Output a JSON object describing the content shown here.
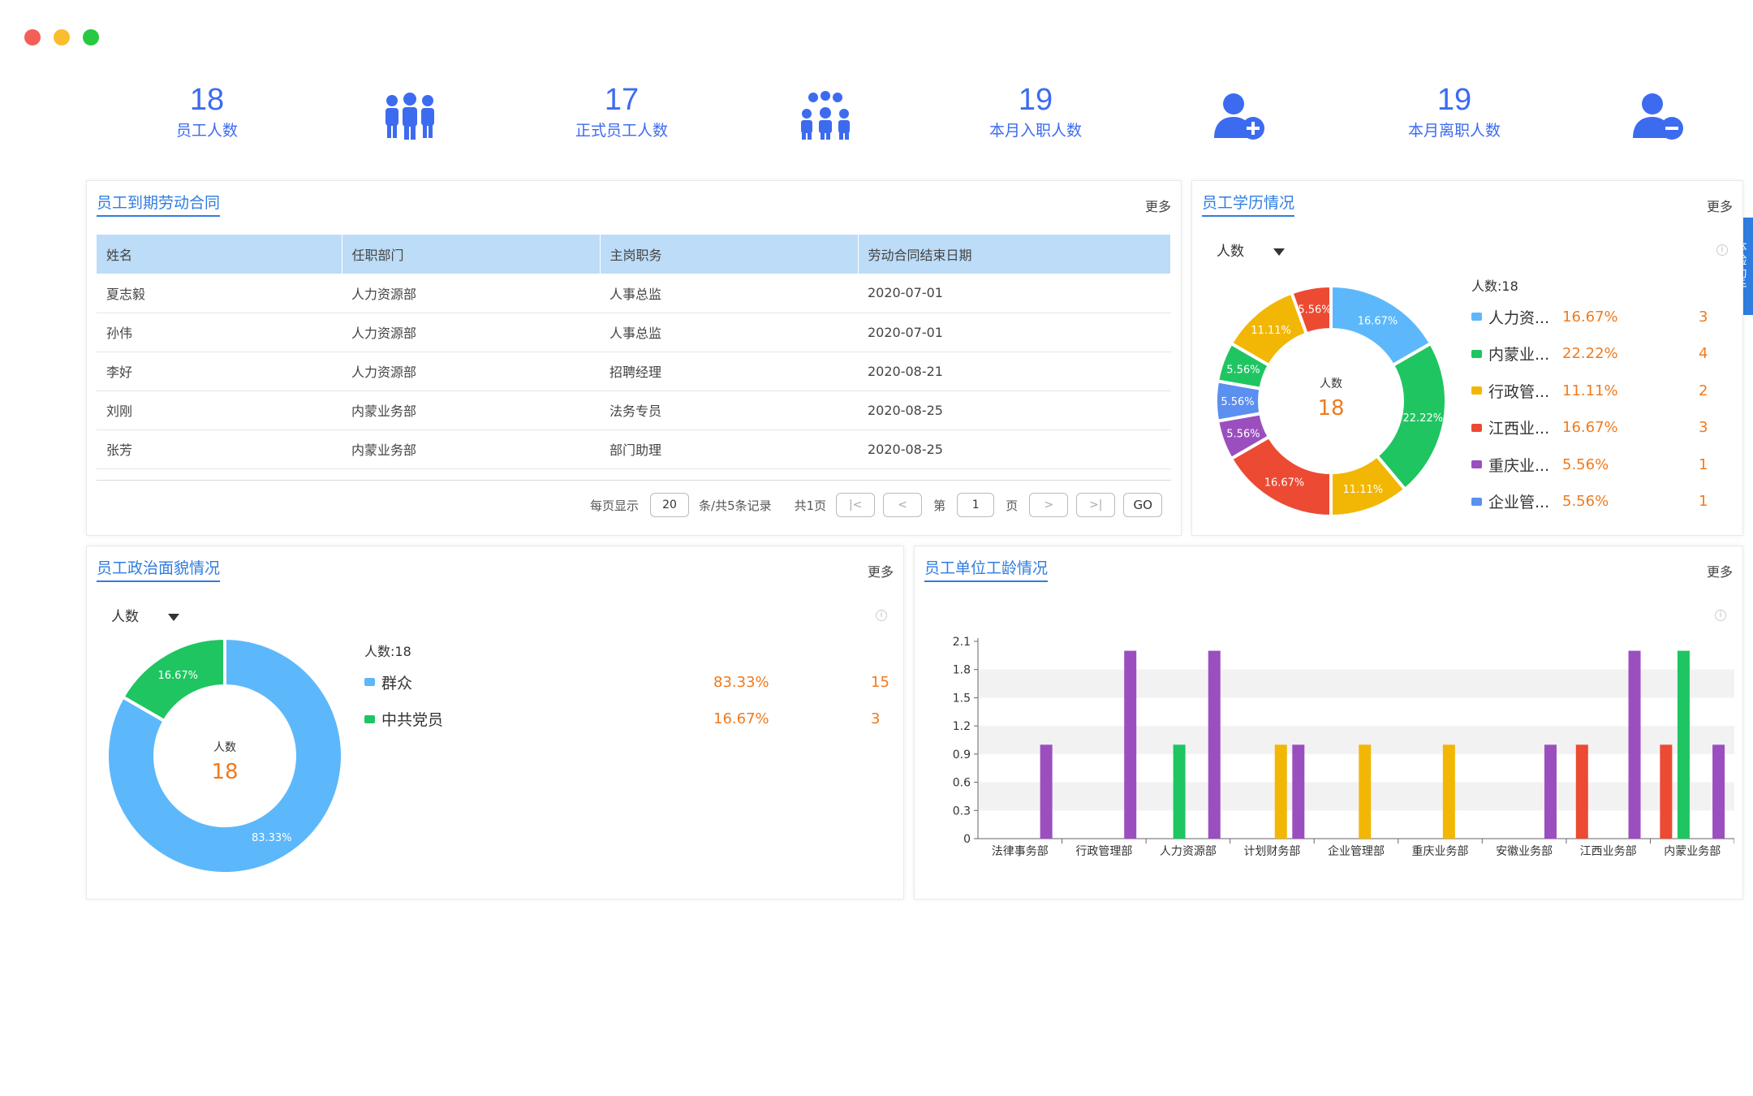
{
  "window": {
    "dots": [
      "#f45f57",
      "#fbbd2e",
      "#28c840"
    ]
  },
  "stats": [
    {
      "value": "18",
      "label": "员工人数",
      "icon": "group-icon"
    },
    {
      "value": "17",
      "label": "正式员工人数",
      "icon": "group-icon"
    },
    {
      "value": "19",
      "label": "本月入职人数",
      "icon": "add-user-icon"
    },
    {
      "value": "19",
      "label": "本月离职人数",
      "icon": "remove-user-icon"
    }
  ],
  "more_label": "更多",
  "assistant_label": "体验助手",
  "contracts": {
    "title": "员工到期劳动合同",
    "headers": [
      "姓名",
      "任职部门",
      "主岗职务",
      "劳动合同结束日期"
    ],
    "rows": [
      [
        "夏志毅",
        "人力资源部",
        "人事总监",
        "2020-07-01"
      ],
      [
        "孙伟",
        "人力资源部",
        "人事总监",
        "2020-07-01"
      ],
      [
        "李好",
        "人力资源部",
        "招聘经理",
        "2020-08-21"
      ],
      [
        "刘刚",
        "内蒙业务部",
        "法务专员",
        "2020-08-25"
      ],
      [
        "张芳",
        "内蒙业务部",
        "部门助理",
        "2020-08-25"
      ]
    ],
    "pager": {
      "per_page_label": "每页显示",
      "per_page": "20",
      "records_label": "条/共5条记录",
      "pages_label": "共1页",
      "first": "|<",
      "prev": "<",
      "page_prefix": "第",
      "page": "1",
      "page_suffix": "页",
      "next": ">",
      "last": ">|",
      "go": "GO"
    }
  },
  "education": {
    "title": "员工学历情况",
    "select": "人数",
    "center_label": "人数",
    "center_value": "18",
    "total": "人数:18",
    "legend": [
      {
        "name": "人力资...",
        "pct": "16.67%",
        "count": "3",
        "color": "#5cb8fb"
      },
      {
        "name": "内蒙业...",
        "pct": "22.22%",
        "count": "4",
        "color": "#1fc561"
      },
      {
        "name": "行政管...",
        "pct": "11.11%",
        "count": "2",
        "color": "#f2b705"
      },
      {
        "name": "江西业...",
        "pct": "16.67%",
        "count": "3",
        "color": "#ec4a33"
      },
      {
        "name": "重庆业...",
        "pct": "5.56%",
        "count": "1",
        "color": "#9b4fbf"
      },
      {
        "name": "企业管...",
        "pct": "5.56%",
        "count": "1",
        "color": "#5b8ff0"
      }
    ]
  },
  "politics": {
    "title": "员工政治面貌情况",
    "select": "人数",
    "center_label": "人数",
    "center_value": "18",
    "total": "人数:18",
    "legend": [
      {
        "name": "群众",
        "pct": "83.33%",
        "count": "15",
        "color": "#5cb8fb"
      },
      {
        "name": "中共党员",
        "pct": "16.67%",
        "count": "3",
        "color": "#1fc561"
      }
    ]
  },
  "seniority": {
    "title": "员工单位工龄情况"
  },
  "chart_data": [
    {
      "type": "pie",
      "title": "员工学历情况",
      "center_label": "人数",
      "center_value": 18,
      "slice_labels": [
        "16.67%",
        "22.22%",
        "11.11%",
        "16.67%",
        "5.56%",
        "5.56%",
        "5.56%",
        "11.11%",
        "5.56%"
      ],
      "values": [
        3,
        4,
        2,
        3,
        1,
        1,
        1,
        2,
        1
      ],
      "colors": [
        "#5cb8fb",
        "#1fc561",
        "#f2b705",
        "#ec4a33",
        "#9b4fbf",
        "#5b8ff0",
        "#1fc561",
        "#f2b705",
        "#ec4a33"
      ]
    },
    {
      "type": "pie",
      "title": "员工政治面貌情况",
      "center_label": "人数",
      "center_value": 18,
      "slice_labels": [
        "83.33%",
        "16.67%"
      ],
      "values": [
        15,
        3
      ],
      "colors": [
        "#5cb8fb",
        "#1fc561"
      ]
    },
    {
      "type": "bar",
      "title": "员工单位工龄情况",
      "categories": [
        "法律事务部",
        "行政管理部",
        "人力资源部",
        "计划财务部",
        "企业管理部",
        "重庆业务部",
        "安徽业务部",
        "江西业务部",
        "内蒙业务部"
      ],
      "ylim": [
        0,
        2.1
      ],
      "yticks": [
        "0",
        "0.3",
        "0.6",
        "0.9",
        "1.2",
        "1.5",
        "1.8",
        "2.1"
      ],
      "grid_bands": true,
      "series": [
        {
          "color": "#ec4a33",
          "values": [
            0,
            0,
            0,
            0,
            0,
            0,
            0,
            1,
            1
          ]
        },
        {
          "color": "#1fc561",
          "values": [
            0,
            0,
            1,
            0,
            0,
            0,
            0,
            0,
            2
          ]
        },
        {
          "color": "#f2b705",
          "values": [
            0,
            0,
            0,
            1,
            1,
            1,
            0,
            0,
            0
          ]
        },
        {
          "color": "#9b4fbf",
          "values": [
            1,
            2,
            2,
            1,
            0,
            0,
            1,
            2,
            1
          ]
        }
      ]
    }
  ]
}
